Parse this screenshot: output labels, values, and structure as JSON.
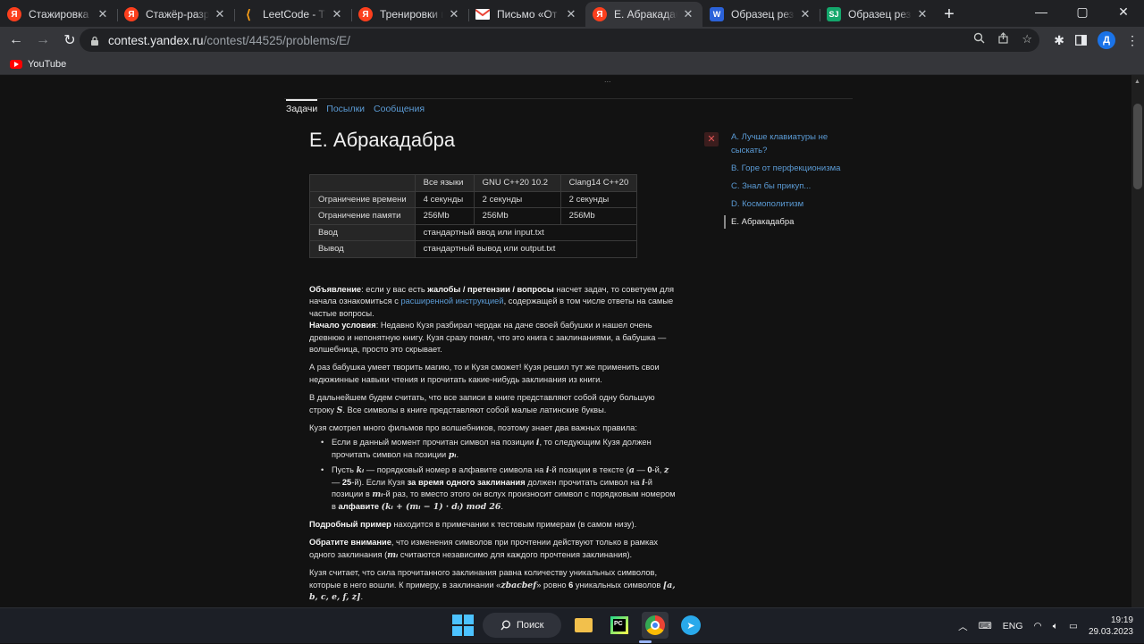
{
  "browser": {
    "tabs": [
      {
        "favicon": "Я",
        "type": "ya",
        "title": "Стажировка в Яндексе",
        "active": false
      },
      {
        "favicon": "Я",
        "type": "ya",
        "title": "Стажёр-разработчик",
        "active": false
      },
      {
        "favicon": "⟨",
        "type": "lc",
        "title": "LeetCode - The World",
        "active": false
      },
      {
        "favicon": "Я",
        "type": "ya",
        "title": "Тренировки по алгоритмам",
        "active": false
      },
      {
        "favicon": "M",
        "type": "gm",
        "title": "Письмо «От команды",
        "active": false
      },
      {
        "favicon": "Я",
        "type": "ya",
        "title": "E. Абракадабра — Контест",
        "active": true
      },
      {
        "favicon": "W",
        "type": "wd",
        "title": "Образец резюме",
        "active": false
      },
      {
        "favicon": "SJ",
        "type": "sj",
        "title": "Образец резюме",
        "active": false
      }
    ],
    "window_controls": {
      "minimize": "—",
      "maximize": "▢",
      "close": "✕"
    },
    "url_host": "contest.yandex.ru",
    "url_path": "/contest/44525/problems/E/",
    "profile_initial": "Д",
    "bookmarks": [
      {
        "label": "YouTube",
        "icon": "youtube-icon"
      }
    ]
  },
  "contest": {
    "handle": "...",
    "subnav": [
      "Задачи",
      "Посылки",
      "Сообщения"
    ],
    "title": "E. Абракадабра",
    "limits_table": {
      "header": [
        "",
        "Все языки",
        "GNU C++20 10.2",
        "Clang14 C++20"
      ],
      "rows": [
        [
          "Ограничение времени",
          "4 секунды",
          "2 секунды",
          "2 секунды"
        ],
        [
          "Ограничение памяти",
          "256Mb",
          "256Mb",
          "256Mb"
        ]
      ],
      "io": [
        [
          "Ввод",
          "стандартный ввод или input.txt"
        ],
        [
          "Вывод",
          "стандартный вывод или output.txt"
        ]
      ]
    },
    "problems": [
      {
        "label": "A. Лучше клавиатуры не сыскать?",
        "current": false
      },
      {
        "label": "B. Горе от перфекционизма",
        "current": false
      },
      {
        "label": "C. Знал бы прикуп...",
        "current": false
      },
      {
        "label": "D. Космополитизм",
        "current": false
      },
      {
        "label": "E. Абракадабра",
        "current": true
      }
    ],
    "close_label": "✕",
    "statement": {
      "announce_b1": "Объявление",
      "announce_t1": ": если у вас есть ",
      "announce_b2": "жалобы / претензии / вопросы",
      "announce_t2": " насчет задач, то советуем для начала ознакомиться с ",
      "announce_link": "расширенной инструкцией",
      "announce_t3": ", содержащей в том числе ответы на самые частые вопросы.",
      "start_b": "Начало условия",
      "start_t": ": Недавно Кузя разбирал чердак на даче своей бабушки и нашел очень древнюю и непонятную книгу. Кузя сразу понял, что это книга с заклинаниями, а бабушка — волшебница, просто это скрывает.",
      "p2": "А раз бабушка умеет творить магию, то и Кузя сможет! Кузя решил тут же применить свои недюжинные навыки чтения и прочитать какие-нибудь заклинания из книги.",
      "p3_t1": "В дальнейшем будем считать, что все записи в книге представляют собой одну большую строку ",
      "p3_s": "S",
      "p3_t2": ". Все символы в книге представляют собой малые латинские буквы.",
      "p4": "Кузя смотрел много фильмов про волшебников, поэтому знает два важных правила:",
      "li1_t1": "Если в данный момент прочитан символ на позиции ",
      "li1_i": "i",
      "li1_t2": ", то следующим Кузя должен прочитать символ на позиции ",
      "li1_p": "pᵢ",
      "li1_t3": ".",
      "li2_t1": "Пусть ",
      "li2_k": "kᵢ",
      "li2_t2": " — порядковый номер в алфавите символа на ",
      "li2_i": "i",
      "li2_t3": "-й позиции в тексте (",
      "li2_a": "a",
      "li2_t4": " — ",
      "li2_zero": "0",
      "li2_t5": "-й, ",
      "li2_z": "z",
      "li2_t6": " — ",
      "li2_25": "25",
      "li2_t7": "-й). Если Кузя ",
      "li2_b": "за время одного заклинания",
      "li2_t8": " должен прочитать символ на ",
      "li2_i2": "i",
      "li2_t9": "-й позиции в ",
      "li2_m": "mᵢ",
      "li2_t10": "-й раз, то вместо этого он вслух произносит символ с порядковым номером в ",
      "li2_b2": "алфавите",
      "li2_formula": "(kᵢ + (mᵢ − 1) · dᵢ)  mod  26",
      "li2_t11": ".",
      "p5_b": "Подробный пример",
      "p5_t": " находится в примечании к тестовым примерам (в самом низу).",
      "p6_b": "Обратите внимание",
      "p6_t1": ", что изменения символов при прочтении действуют только в рамках одного заклинания (",
      "p6_m": "mᵢ",
      "p6_t2": " считаются независимо для каждого прочтения заклинания).",
      "p7_t1": "Кузя считает, что сила прочитанного заклинания равна количеству уникальных символов, которые в него вошли. К примеру, в заклинании «",
      "p7_word": "zbacbef",
      "p7_t2": "» ровно ",
      "p7_n": "6",
      "p7_t3": " уникальных символов ",
      "p7_set": "[a, b, c, e, f, z]",
      "p7_t4": "."
    }
  },
  "taskbar": {
    "search_label": "Поиск",
    "lang": "ENG",
    "time": "19:19",
    "date": "29.03.2023"
  }
}
